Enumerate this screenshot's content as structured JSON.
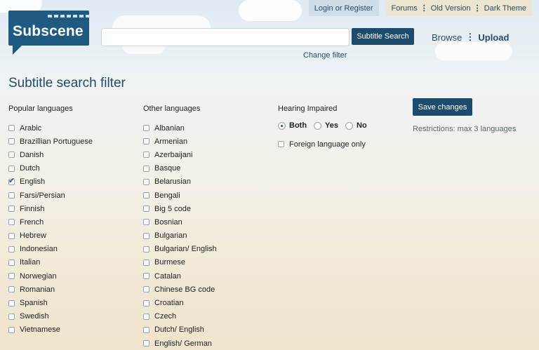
{
  "header": {
    "logo_text": "Subscene",
    "login_link": "Login or Register",
    "forums_link": "Forums",
    "old_version_link": "Old Version",
    "dark_theme_link": "Dark Theme",
    "search_placeholder": "",
    "search_button": "Subtitle Search",
    "change_filter": "Change filter",
    "browse_link": "Browse",
    "upload_link": "Upload"
  },
  "page": {
    "title": "Subtitle search filter"
  },
  "popular": {
    "heading": "Popular languages",
    "items": [
      {
        "label": "Arabic",
        "checked": false
      },
      {
        "label": "Brazillian Portuguese",
        "checked": false
      },
      {
        "label": "Danish",
        "checked": false
      },
      {
        "label": "Dutch",
        "checked": false
      },
      {
        "label": "English",
        "checked": true
      },
      {
        "label": "Farsi/Persian",
        "checked": false
      },
      {
        "label": "Finnish",
        "checked": false
      },
      {
        "label": "French",
        "checked": false
      },
      {
        "label": "Hebrew",
        "checked": false
      },
      {
        "label": "Indonesian",
        "checked": false
      },
      {
        "label": "Italian",
        "checked": false
      },
      {
        "label": "Norwegian",
        "checked": false
      },
      {
        "label": "Romanian",
        "checked": false
      },
      {
        "label": "Spanish",
        "checked": false
      },
      {
        "label": "Swedish",
        "checked": false
      },
      {
        "label": "Vietnamese",
        "checked": false
      }
    ]
  },
  "other": {
    "heading": "Other languages",
    "items": [
      {
        "label": "Albanian",
        "checked": false
      },
      {
        "label": "Armenian",
        "checked": false
      },
      {
        "label": "Azerbaijani",
        "checked": false
      },
      {
        "label": "Basque",
        "checked": false
      },
      {
        "label": "Belarusian",
        "checked": false
      },
      {
        "label": "Bengali",
        "checked": false
      },
      {
        "label": "Big 5 code",
        "checked": false
      },
      {
        "label": "Bosnian",
        "checked": false
      },
      {
        "label": "Bulgarian",
        "checked": false
      },
      {
        "label": "Bulgarian/ English",
        "checked": false
      },
      {
        "label": "Burmese",
        "checked": false
      },
      {
        "label": "Catalan",
        "checked": false
      },
      {
        "label": "Chinese BG code",
        "checked": false
      },
      {
        "label": "Croatian",
        "checked": false
      },
      {
        "label": "Czech",
        "checked": false
      },
      {
        "label": "Dutch/ English",
        "checked": false
      },
      {
        "label": "English/ German",
        "checked": false
      }
    ]
  },
  "hearing": {
    "heading": "Hearing Impaired",
    "options": [
      {
        "label": "Both",
        "selected": true
      },
      {
        "label": "Yes",
        "selected": false
      },
      {
        "label": "No",
        "selected": false
      }
    ],
    "foreign_only_label": "Foreign language only",
    "foreign_only_checked": false
  },
  "actions": {
    "save_button": "Save changes",
    "restrictions": "Restrictions: max 3 languages"
  },
  "colors": {
    "brand": "#1e5a82",
    "button": "#1e4b6b",
    "title": "#244b6a"
  }
}
